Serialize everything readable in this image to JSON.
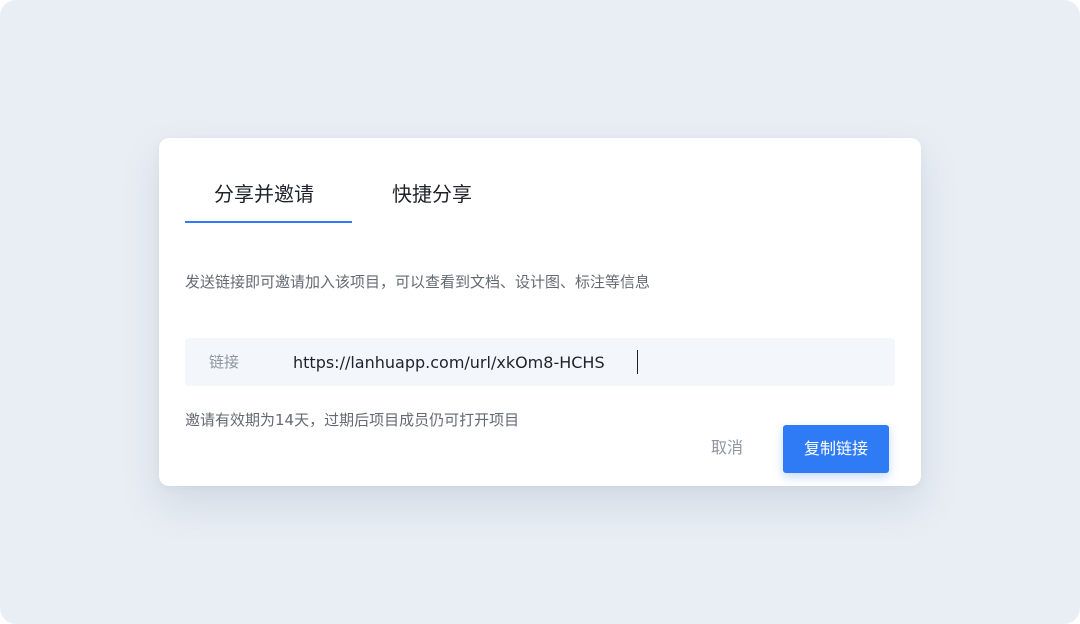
{
  "dialog": {
    "tabs": [
      {
        "label": "分享并邀请",
        "active": true
      },
      {
        "label": "快捷分享",
        "active": false
      }
    ],
    "description": "发送链接即可邀请加入该项目，可以查看到文档、设计图、标注等信息",
    "link": {
      "label": "链接",
      "value": "https://lanhuapp.com/url/xkOm8-HCHS"
    },
    "expiry_note": "邀请有效期为14天，过期后项目成员仍可打开项目",
    "buttons": {
      "cancel": "取消",
      "copy": "复制链接"
    }
  },
  "colors": {
    "accent": "#2f7bf5",
    "background": "#e9eef4",
    "field_background": "#f3f6fb"
  }
}
